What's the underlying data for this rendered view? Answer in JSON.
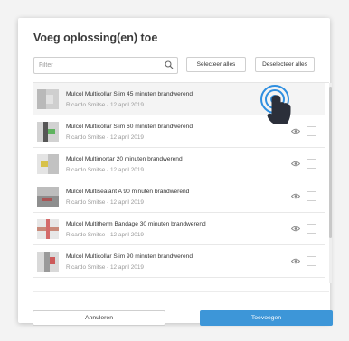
{
  "dialog": {
    "title": "Voeg oplossing(en) toe",
    "filter_placeholder": "Filter",
    "select_all_label": "Selecteer alles",
    "deselect_all_label": "Deselecteer alles",
    "cancel_label": "Annuleren",
    "add_label": "Toevoegen"
  },
  "items": [
    {
      "name": "Mulcol Multicollar Slim 45 minuten brandwerend",
      "meta": "Ricardo Smitse - 12 april 2019",
      "icon": "eye-icon",
      "selected": false
    },
    {
      "name": "Mulcol Multicollar Slim 60 minuten brandwerend",
      "meta": "Ricardo Smitse - 12 april 2019",
      "icon": "eye-icon",
      "selected": false
    },
    {
      "name": "Mulcol Multimortar 20 minuten brandwerend",
      "meta": "Ricardo Smitse - 12 april 2019",
      "icon": "eye-icon",
      "selected": false
    },
    {
      "name": "Mulcol Multisealant A 90 minuten brandwerend",
      "meta": "Ricardo Smitse - 12 april 2019",
      "icon": "eye-icon",
      "selected": false
    },
    {
      "name": "Mulcol Multitherm Bandage 30 minuten brandwerend",
      "meta": "Ricardo Smitse - 12 april 2019",
      "icon": "eye-icon",
      "selected": false
    },
    {
      "name": "Mulcol Multicollar Slim 90 minuten brandwerend",
      "meta": "Ricardo Smitse - 12 april 2019",
      "icon": "eye-icon",
      "selected": false
    }
  ],
  "colors": {
    "primary": "#3d96d8",
    "touch_hint": "#2f8fe0"
  }
}
